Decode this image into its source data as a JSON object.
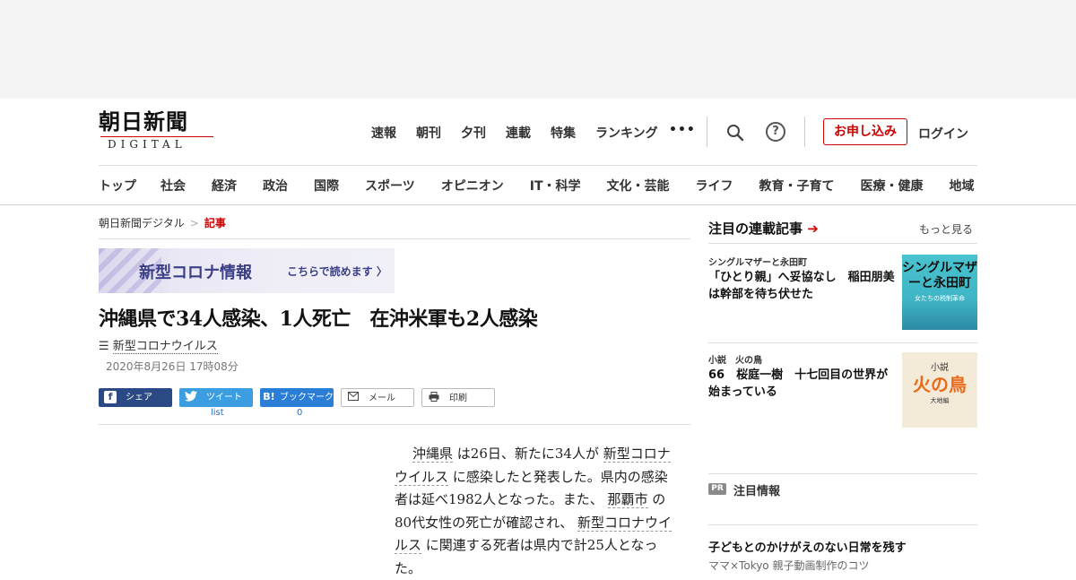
{
  "logo": {
    "main": "朝日新聞",
    "sub": "DIGITAL"
  },
  "topnav": [
    "速報",
    "朝刊",
    "夕刊",
    "連載",
    "特集",
    "ランキング"
  ],
  "more_label": "•••",
  "help_label": "?",
  "apply_label": "お申し込み",
  "login_label": "ログイン",
  "categories": [
    "トップ",
    "社会",
    "経済",
    "政治",
    "国際",
    "スポーツ",
    "オピニオン",
    "IT・科学",
    "文化・芸能",
    "ライフ",
    "教育・子育て",
    "医療・健康",
    "地域"
  ],
  "breadcrumb": {
    "home": "朝日新聞デジタル",
    "sep": ">",
    "current": "記事"
  },
  "banner": {
    "title": "新型コロナ情報",
    "link": "こちらで読めます 〉"
  },
  "article": {
    "headline": "沖縄県で34人感染、1人死亡　在沖米軍も2人感染",
    "topic_icon": "☰",
    "topic": "新型コロナウイルス",
    "date": "2020年8月26日 17時08分",
    "share": {
      "facebook": "シェア",
      "twitter": "ツイート",
      "hatena": "ブックマーク",
      "mail": "メール",
      "print": "印刷",
      "twitter_count": "list",
      "hatena_count": "0"
    },
    "body": {
      "p1": "沖縄県",
      "p2": " は26日、新たに34人が ",
      "p3": "新型コロナウイルス",
      "p4": " に感染したと発表した。県内の感染者は延べ1982人となった。また、 ",
      "p5": "那覇市",
      "p6": " の80代女性の死亡が確認され、 ",
      "p7": "新型コロナウイルス",
      "p8": " に関連する死者は県内で計25人となった。"
    }
  },
  "sidebar": {
    "heading": "注目の連載記事",
    "more": "もっと見る",
    "items": [
      {
        "label": "シングルマザーと永田町",
        "title": "「ひとり親」へ妥協なし　稲田朋美は幹部を待ち伏せた",
        "thumb_title": "シングルマザーと永田町",
        "thumb_sub": "女たちの税制革命"
      },
      {
        "label": "小説　火の鳥",
        "title": "66　桜庭一樹　十七回目の世界が始まっている",
        "thumb_top": "小説",
        "thumb_title": "火の鳥",
        "thumb_sub": "大地編"
      }
    ],
    "pr_badge": "PR",
    "pr_label": "注目情報",
    "pr_title": "子どもとのかけがえのない日常を残す",
    "pr_sub": "ママ×Tokyo 親子動画制作のコツ"
  },
  "colors": {
    "accent": "#cc0000",
    "facebook": "#2b4a85",
    "twitter": "#3c9ee0",
    "hatena": "#2b7ed6"
  }
}
